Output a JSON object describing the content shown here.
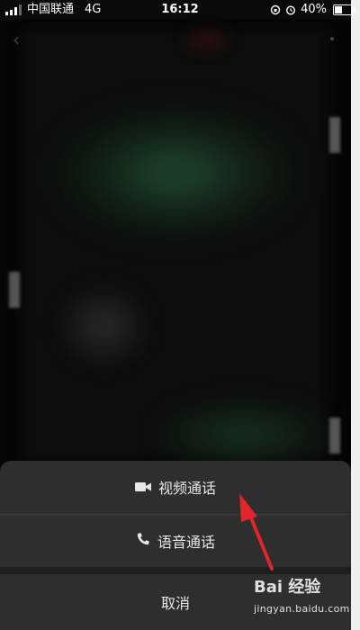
{
  "status_bar": {
    "carrier": "中国联通",
    "network": "4G",
    "time": "16:12",
    "battery": "40%"
  },
  "background": {
    "description_icons": [
      "back-icon",
      "more-icon"
    ],
    "colors": {
      "dark": "#0a0a0a",
      "green_glow": "#235037"
    }
  },
  "sheet": {
    "video_call_label": "视频通话",
    "voice_call_label": "语音通话",
    "cancel_label": "取消",
    "background_color": "#2e2e2e",
    "icons": [
      "video-camera-icon",
      "phone-icon"
    ]
  },
  "annotation": {
    "arrow_color": "#e0262a"
  },
  "watermark": {
    "brand_text": "Bai 经验",
    "url": "jingyan.baidu.com"
  }
}
